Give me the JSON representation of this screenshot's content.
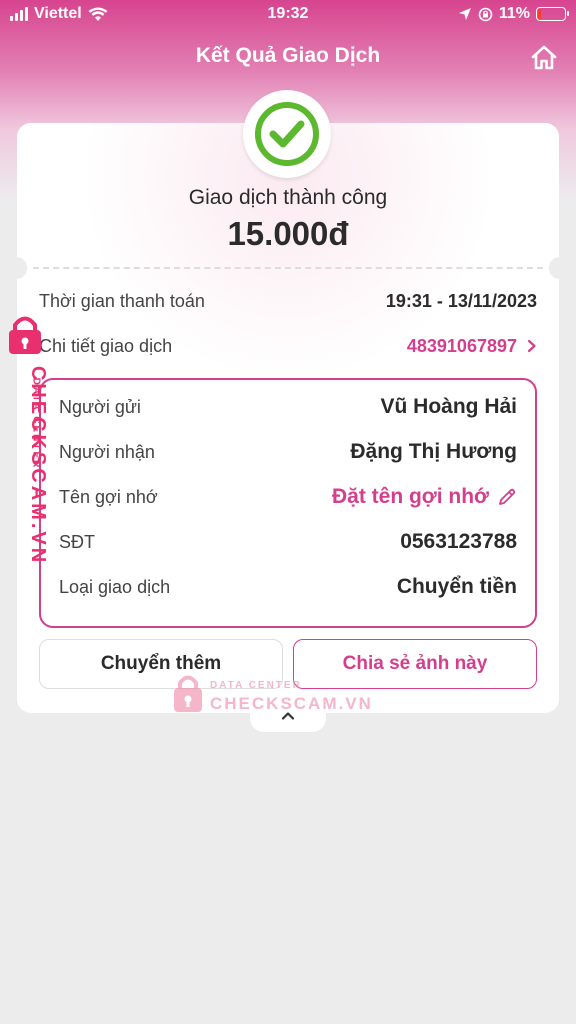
{
  "status_bar": {
    "carrier": "Viettel",
    "time": "19:32",
    "battery": "11%",
    "battery_level": 0.11
  },
  "header": {
    "title": "Kết Quả Giao Dịch",
    "home_icon": "home-icon"
  },
  "result": {
    "status_text": "Giao dịch thành công",
    "amount": "15.000đ",
    "check_icon": "check-circle-icon"
  },
  "summary": {
    "time_label": "Thời gian thanh toán",
    "time_value": "19:31 - 13/11/2023",
    "detail_label": "Chi tiết giao dịch",
    "detail_value": "48391067897"
  },
  "details": {
    "sender_label": "Người gửi",
    "sender_value": "Vũ Hoàng Hải",
    "receiver_label": "Người nhận",
    "receiver_value": "Đặng Thị Hương",
    "nickname_label": "Tên gợi nhớ",
    "nickname_value": "Đặt tên gợi nhớ",
    "phone_label": "SĐT",
    "phone_value": "0563123788",
    "type_label": "Loại giao dịch",
    "type_value": "Chuyển tiền"
  },
  "buttons": {
    "transfer_more": "Chuyển thêm",
    "share_image": "Chia sẻ ảnh này"
  },
  "watermark": {
    "brand": "CHECKSCAM.VN",
    "sub": "DATA CENTER"
  },
  "colors": {
    "brand_pink": "#d43f8d",
    "success_green": "#5cb82e",
    "watermark_red": "#e8306e"
  }
}
